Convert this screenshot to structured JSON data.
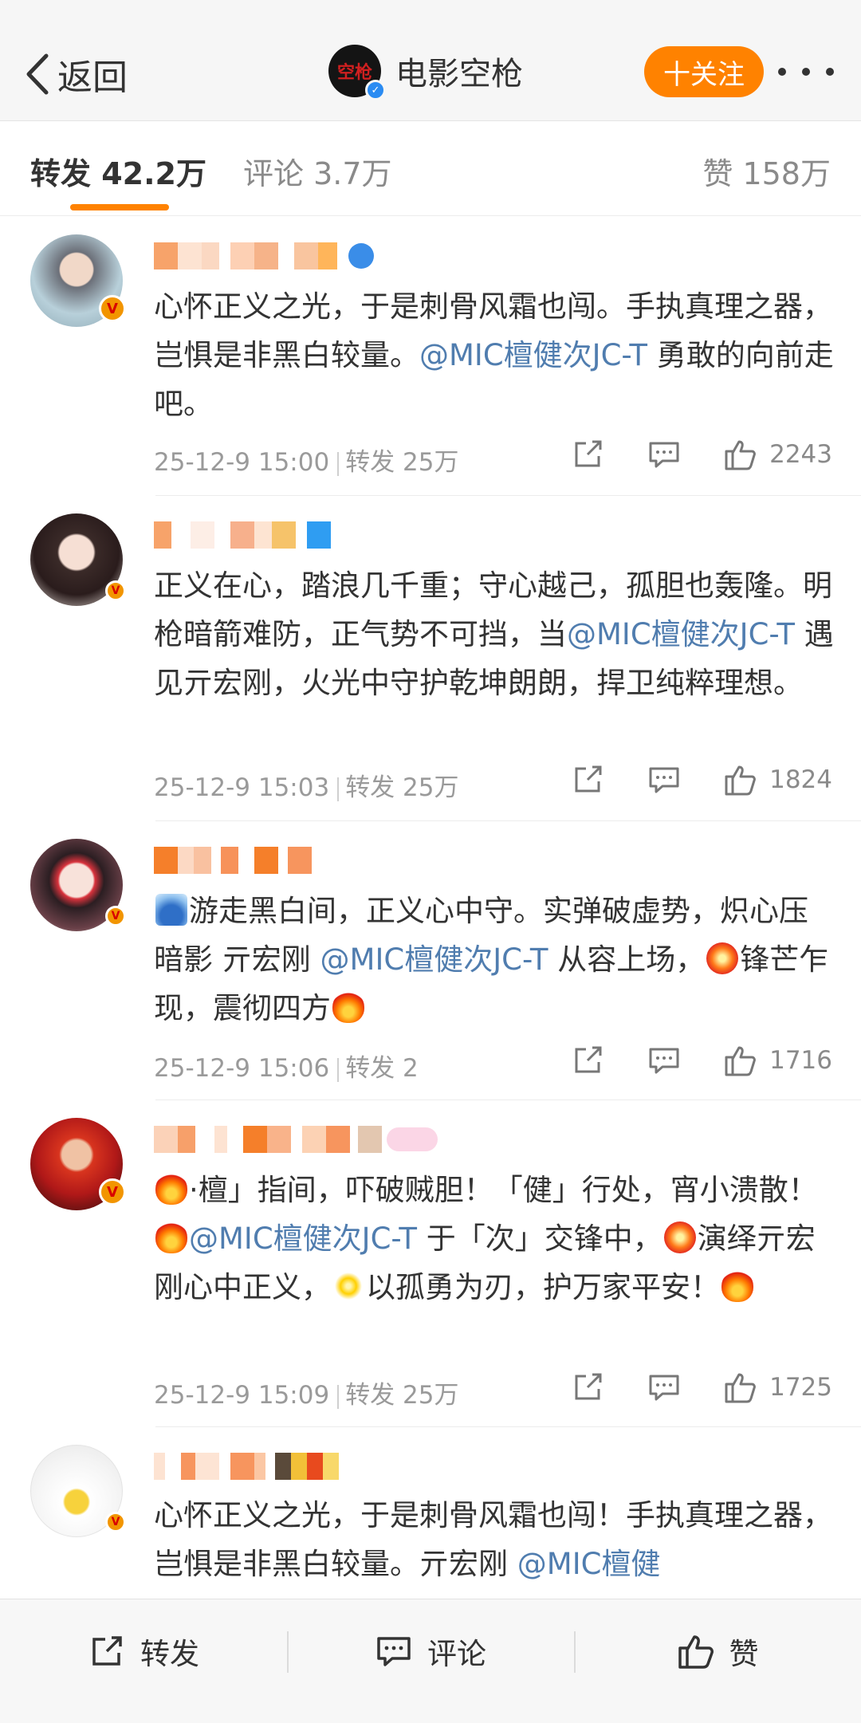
{
  "header": {
    "back_label": "返回",
    "account_avatar_text": "空枪",
    "account_name": "电影空枪",
    "follow_label": "十关注",
    "colors": {
      "accent": "#ff8200",
      "mention": "#507daf",
      "verified_blue": "#2a8bf2",
      "verified_orange": "#f29500"
    }
  },
  "tabs": {
    "repost": "转发 42.2万",
    "comment": "评论 3.7万",
    "like": "赞 158万"
  },
  "reposts": [
    {
      "text_before": "心怀正义之光，于是刺骨风霜也闯。手执真理之器，岂惧是非黑白较量。",
      "mention": "@MIC檀健次JC-T",
      "text_after": " 勇敢的向前走吧。",
      "time": "25-12-9 15:00",
      "repost_label": "转发 25万",
      "likes": "2243"
    },
    {
      "text_before": "正义在心，踏浪几千重；守心越己，孤胆也轰隆。明枪暗箭难防，正气势不可挡，当",
      "mention": "@MIC檀健次JC-T",
      "text_after": " 遇见亓宏刚，火光中守护乾坤朗朗，捍卫纯粹理想。",
      "time": "25-12-9 15:03",
      "repost_label": "转发 25万",
      "likes": "1824"
    },
    {
      "text_before": "游走黑白间，正义心中守。实弹破虚势，炽心压暗影 亓宏刚 ",
      "mention": "@MIC檀健次JC-T",
      "text_after": " 从容上场，",
      "text_end": "锋芒乍现，震彻四方",
      "time": "25-12-9 15:06",
      "repost_label": "转发 2",
      "likes": "1716"
    },
    {
      "text_before": "·檀」指间，吓破贼胆！「健」行处，宵小溃散！",
      "mention": "@MIC檀健次JC-T",
      "text_after": " 于「次」交锋中，",
      "text_mid": "演绎亓宏刚心中正义，",
      "text_end": "以孤勇为刃，护万家平安！",
      "time": "25-12-9 15:09",
      "repost_label": "转发 25万",
      "likes": "1725"
    },
    {
      "text_before": "心怀正义之光，于是刺骨风霜也闯！手执真理之器，岂惧是非黑白较量。亓宏刚 ",
      "mention": "@MIC檀健"
    }
  ],
  "bottom_bar": {
    "repost": "转发",
    "comment": "评论",
    "like": "赞"
  }
}
